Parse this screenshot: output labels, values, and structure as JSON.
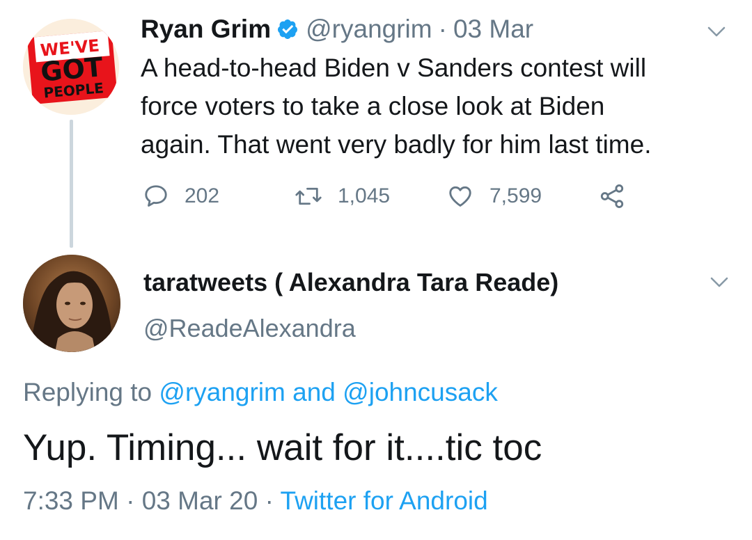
{
  "parent_tweet": {
    "author_name": "Ryan Grim",
    "handle": "@ryangrim",
    "separator": "·",
    "date": "03 Mar",
    "verified": true,
    "avatar": {
      "icon": "we-got-people-sign",
      "line1": "WE'VE",
      "line2": "GOT",
      "line3": "PEOPLE"
    },
    "body_lines": [
      "A head-to-head Biden v Sanders contest will",
      "force voters to take a close look at Biden",
      "again. That went very badly for him last time."
    ],
    "actions": {
      "replies": "202",
      "retweets": "1,045",
      "likes": "7,599"
    }
  },
  "reply_tweet": {
    "author_name": "taratweets ( Alexandra Tara Reade)",
    "handle": "@ReadeAlexandra",
    "replying_prefix": "Replying to",
    "replying_to_1": "@ryangrim",
    "replying_and": "and",
    "replying_to_2": "@johncusack",
    "text": "Yup. Timing... wait for it....tic toc",
    "time": "7:33 PM",
    "separator": "·",
    "date": "03 Mar 20",
    "source": "Twitter for Android"
  },
  "colors": {
    "text_primary": "#14171a",
    "text_secondary": "#657786",
    "link": "#1da1f2",
    "thread_line": "#ccd6dd",
    "avatar_sign_red": "#e8141b"
  }
}
